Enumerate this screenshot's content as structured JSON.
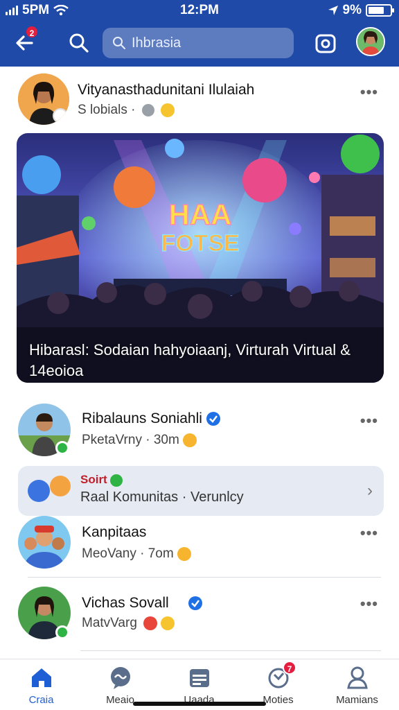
{
  "status_bar": {
    "carrier_time": "5PM",
    "clock": "12:PM",
    "battery_percent": "9%"
  },
  "nav": {
    "back_badge": "2",
    "search_placeholder": "Ihbrasia"
  },
  "post": {
    "author": "Vityanasthadunitani Ilulaiah",
    "meta": "S lobials ·",
    "hero_caption": "Hibarasl: Sodaian hahyoiaanj, Virturah Virtual & 14eoioa",
    "hero_sign_line1": "HAA",
    "hero_sign_line2": "FOTSE"
  },
  "items": [
    {
      "name": "Ribalauns Soniahli",
      "meta": "PketaVrny · 30m",
      "verified": true
    },
    {
      "name": "Kanpitaas",
      "meta": "MeoVany · 7om",
      "verified": false
    },
    {
      "name": "Vichas Sovall",
      "meta": "MatvVarg",
      "verified": true
    }
  ],
  "community": {
    "title": "Soirt",
    "text": "Raal Komunitas · Verunlcy"
  },
  "more_label": "•••",
  "tabs": [
    {
      "label": "Craia",
      "icon": "home-icon",
      "active": true
    },
    {
      "label": "Meaio",
      "icon": "chat-icon",
      "active": false
    },
    {
      "label": "Uaada",
      "icon": "calendar-icon",
      "active": false
    },
    {
      "label": "Moties",
      "icon": "notifications-icon",
      "active": false,
      "badge": "7"
    },
    {
      "label": "Mamians",
      "icon": "profile-icon",
      "active": false
    }
  ],
  "colors": {
    "brand": "#1f4aa8",
    "accent": "#1f5fd6",
    "badge": "#e41e3f",
    "online": "#2fb344"
  }
}
